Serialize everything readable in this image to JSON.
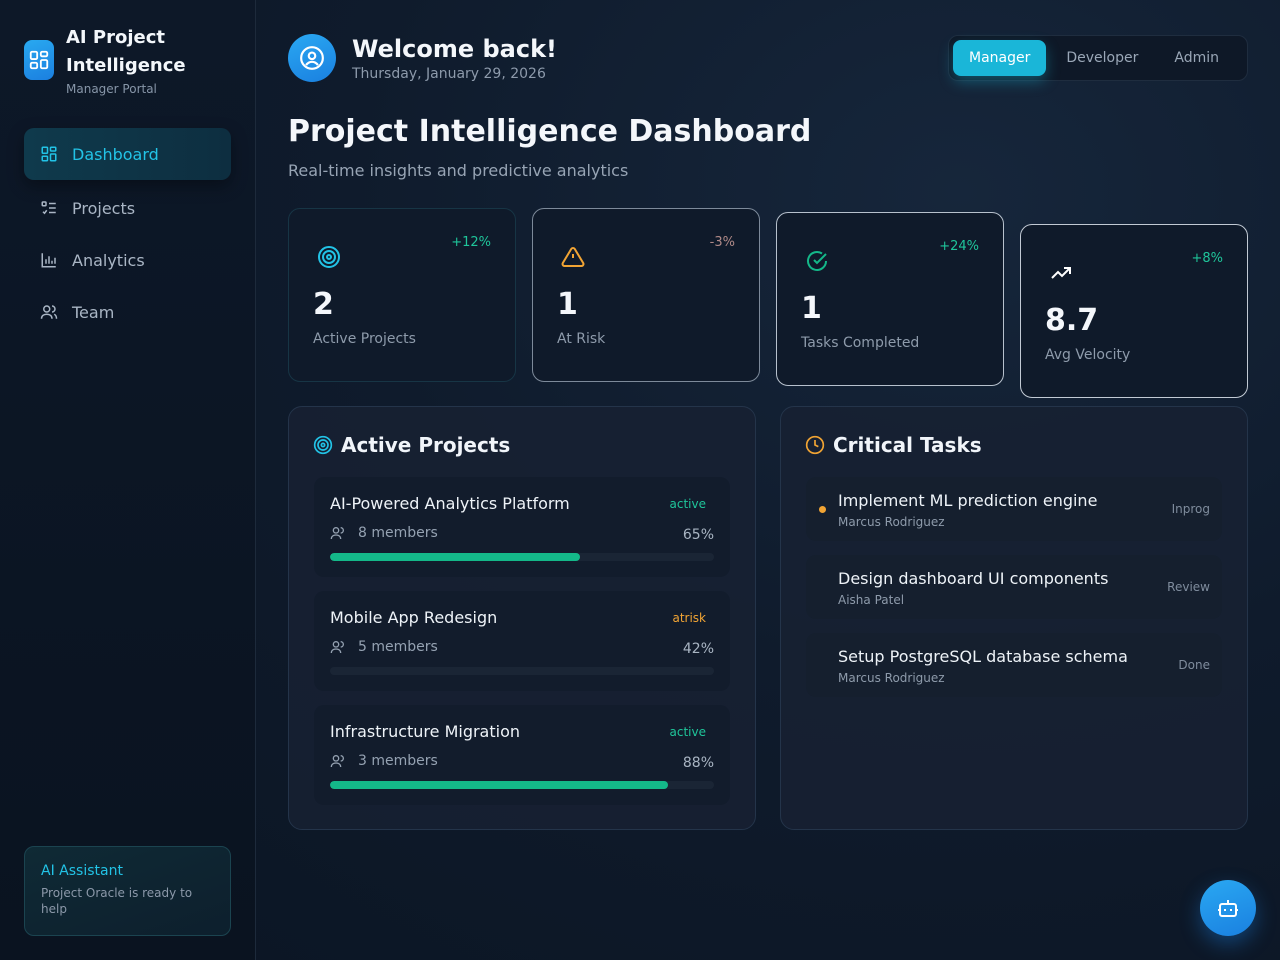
{
  "brand": {
    "title": "AI Project Intelligence",
    "subtitle": "Manager Portal"
  },
  "nav": {
    "items": [
      {
        "label": "Dashboard",
        "icon": "dashboard-icon",
        "active": true
      },
      {
        "label": "Projects",
        "icon": "list-icon",
        "active": false
      },
      {
        "label": "Analytics",
        "icon": "bar-chart-icon",
        "active": false
      },
      {
        "label": "Team",
        "icon": "users-icon",
        "active": false
      }
    ]
  },
  "assistant": {
    "title": "AI Assistant",
    "text": "Project Oracle is ready to help"
  },
  "header": {
    "welcome": "Welcome back!",
    "date": "Thursday, January 29, 2026"
  },
  "roles": {
    "options": [
      "Manager",
      "Developer",
      "Admin"
    ],
    "selected": "Manager"
  },
  "page": {
    "title": "Project Intelligence Dashboard",
    "subtitle": "Real-time insights and predictive analytics"
  },
  "stats": [
    {
      "value": "2",
      "label": "Active Projects",
      "trend": "+12%",
      "icon": "target-icon"
    },
    {
      "value": "1",
      "label": "At Risk",
      "trend": "-3%",
      "icon": "warning-icon"
    },
    {
      "value": "1",
      "label": "Tasks Completed",
      "trend": "+24%",
      "icon": "check-circle-icon"
    },
    {
      "value": "8.7",
      "label": "Avg Velocity",
      "trend": "+8%",
      "icon": "trending-up-icon"
    }
  ],
  "projects_panel": {
    "title": "Active Projects",
    "items": [
      {
        "name": "AI-Powered Analytics Platform",
        "status": "active",
        "members": "8 members",
        "progress": "65%",
        "progress_value": 65
      },
      {
        "name": "Mobile App Redesign",
        "status": "atrisk",
        "members": "5 members",
        "progress": "42%",
        "progress_value": 0
      },
      {
        "name": "Infrastructure Migration",
        "status": "active",
        "members": "3 members",
        "progress": "88%",
        "progress_value": 88
      }
    ]
  },
  "tasks_panel": {
    "title": "Critical Tasks",
    "items": [
      {
        "title": "Implement ML prediction engine",
        "owner": "Marcus Rodriguez",
        "status": "Inprog"
      },
      {
        "title": "Design dashboard UI components",
        "owner": "Aisha Patel",
        "status": "Review"
      },
      {
        "title": "Setup PostgreSQL database schema",
        "owner": "Marcus Rodriguez",
        "status": "Done"
      }
    ]
  },
  "colors": {
    "accent": "#1ab6d8",
    "success": "#14b889",
    "warning": "#f1a434"
  }
}
